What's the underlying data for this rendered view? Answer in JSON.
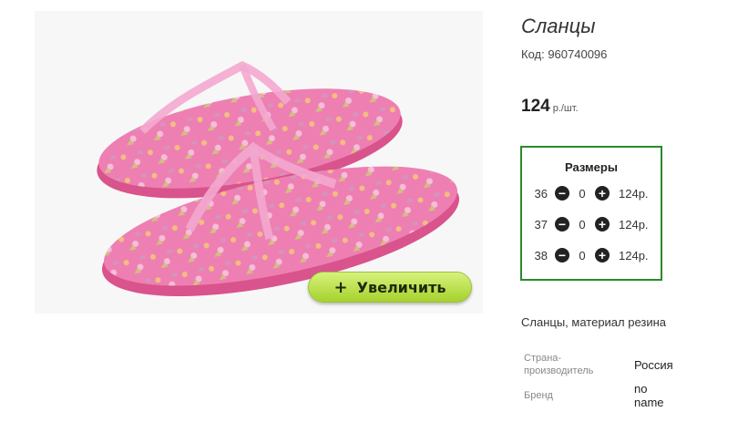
{
  "product": {
    "title": "Сланцы",
    "code": "Код: 960740096",
    "price": "124",
    "price_unit": "р./шт.",
    "description": "Сланцы, материал резина",
    "zoom_label": "Увеличить",
    "zoom_icon": "plus-icon"
  },
  "sizes": {
    "heading": "Размеры",
    "rows": [
      {
        "size": "36",
        "qty": "0",
        "price": "124р."
      },
      {
        "size": "37",
        "qty": "0",
        "price": "124р."
      },
      {
        "size": "38",
        "qty": "0",
        "price": "124р."
      }
    ]
  },
  "properties": [
    {
      "label_lines": [
        "Страна-",
        "производитель"
      ],
      "value_lines": [
        "Россия"
      ]
    },
    {
      "label_lines": [
        "Бренд"
      ],
      "value_lines": [
        "no",
        "name"
      ]
    }
  ],
  "colors": {
    "sizes_border": "#2a8a2a",
    "zoom_button": "#b8e04a",
    "sandal_pink": "#e76fa5"
  }
}
